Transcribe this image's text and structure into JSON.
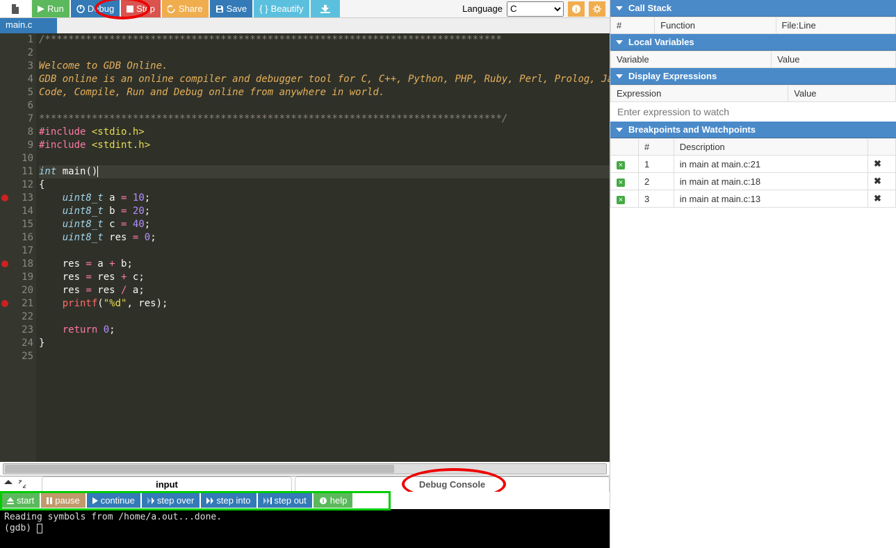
{
  "toolbar": {
    "run": "Run",
    "debug": "Debug",
    "stop": "Stop",
    "share": "Share",
    "save": "Save",
    "beautify": "Beautify",
    "language_label": "Language",
    "language_value": "C"
  },
  "file_tab": "main.c",
  "code_lines": [
    {
      "n": 1,
      "html": "<span class='cm2'>/******************************************************************************</span>"
    },
    {
      "n": 2,
      "html": ""
    },
    {
      "n": 3,
      "html": "<span class='cm'>Welcome to GDB Online.</span>"
    },
    {
      "n": 4,
      "html": "<span class='cm'>GDB online is an online compiler and debugger tool for C, C++, Python, PHP, Ruby, Perl, Prolog, Javascr</span>"
    },
    {
      "n": 5,
      "html": "<span class='cm'>Code, Compile, Run and Debug online from anywhere in world.</span>"
    },
    {
      "n": 6,
      "html": ""
    },
    {
      "n": 7,
      "html": "<span class='cm2'>*******************************************************************************/</span>"
    },
    {
      "n": 8,
      "html": "<span class='inc'>#include</span> <span class='incstr'>&lt;stdio.h&gt;</span>"
    },
    {
      "n": 9,
      "html": "<span class='inc'>#include</span> <span class='incstr'>&lt;stdint.h&gt;</span>"
    },
    {
      "n": 10,
      "html": ""
    },
    {
      "n": 11,
      "html": "<span class='ty'>int</span> <span class='id'>main</span>()<span style='display:inline-block;width:1px;height:16px;background:#fff;vertical-align:middle'></span>",
      "cur": true
    },
    {
      "n": 12,
      "html": "{"
    },
    {
      "n": 13,
      "html": "    <span class='ty'>uint8_t</span> a <span class='kw'>=</span> <span class='nu'>10</span>;",
      "bp": true
    },
    {
      "n": 14,
      "html": "    <span class='ty'>uint8_t</span> b <span class='kw'>=</span> <span class='nu'>20</span>;"
    },
    {
      "n": 15,
      "html": "    <span class='ty'>uint8_t</span> c <span class='kw'>=</span> <span class='nu'>40</span>;"
    },
    {
      "n": 16,
      "html": "    <span class='ty'>uint8_t</span> res <span class='kw'>=</span> <span class='nu'>0</span>;"
    },
    {
      "n": 17,
      "html": ""
    },
    {
      "n": 18,
      "html": "    res <span class='kw'>=</span> a <span class='kw'>+</span> b;",
      "bp": true
    },
    {
      "n": 19,
      "html": "    res <span class='kw'>=</span> res <span class='kw'>+</span> c;"
    },
    {
      "n": 20,
      "html": "    res <span class='kw'>=</span> res <span class='kw'>/</span> a;"
    },
    {
      "n": 21,
      "html": "    <span class='id' style='color:#ff6b6b'>printf</span>(<span class='st'>\"%d\"</span>, res);",
      "bp": true
    },
    {
      "n": 22,
      "html": ""
    },
    {
      "n": 23,
      "html": "    <span class='kw'>return</span> <span class='nu'>0</span>;"
    },
    {
      "n": 24,
      "html": "}"
    },
    {
      "n": 25,
      "html": ""
    }
  ],
  "bottom": {
    "input_tab": "input",
    "debug_console_tab": "Debug Console",
    "console_text": "Reading symbols from /home/a.out...done.\n(gdb) "
  },
  "dbg": {
    "start": "start",
    "pause": "pause",
    "continue": "continue",
    "stepover": "step over",
    "stepinto": "step into",
    "stepout": "step out",
    "help": "help"
  },
  "panels": {
    "callstack": {
      "title": "Call Stack",
      "cols": [
        "#",
        "Function",
        "File:Line"
      ]
    },
    "locals": {
      "title": "Local Variables",
      "cols": [
        "Variable",
        "Value"
      ]
    },
    "display": {
      "title": "Display Expressions",
      "cols": [
        "Expression",
        "Value"
      ],
      "placeholder": "Enter expression to watch"
    },
    "breakpoints": {
      "title": "Breakpoints and Watchpoints",
      "cols": [
        "",
        "#",
        "Description",
        ""
      ],
      "rows": [
        {
          "n": "1",
          "desc": "in main at main.c:21"
        },
        {
          "n": "2",
          "desc": "in main at main.c:18"
        },
        {
          "n": "3",
          "desc": "in main at main.c:13"
        }
      ]
    }
  }
}
